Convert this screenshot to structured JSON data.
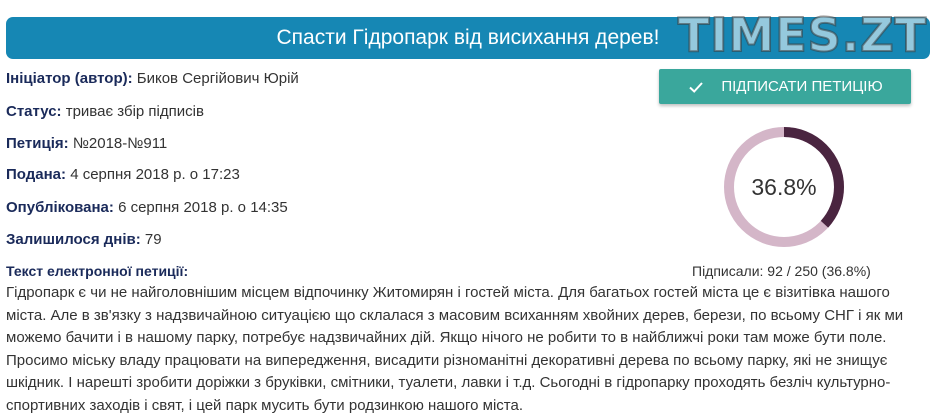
{
  "header": {
    "title": "Спасти Гідропарк від висихання дерев!",
    "watermark": "TIMES.ZT",
    "bg_color": "#1687b4"
  },
  "meta": {
    "initiator_label": "Ініціатор (автор):",
    "initiator_value": "Биков Сергійович Юрій",
    "status_label": "Статус:",
    "status_value": "триває збір підписів",
    "petition_label": "Петиція:",
    "petition_value": "№2018-№911",
    "submitted_label": "Подана:",
    "submitted_value": "4 серпня 2018 р. о 17:23",
    "published_label": "Опублікована:",
    "published_value": "6 серпня 2018 р. о 14:35",
    "days_left_label": "Залишилося днів:",
    "days_left_value": "79"
  },
  "sign_button": {
    "label": "ПІДПИСАТИ ПЕТИЦІЮ",
    "icon": "check-icon",
    "color": "#3aa79c"
  },
  "progress": {
    "percent_label": "36.8%",
    "fraction": 0.368,
    "signed_text": "Підписали: 92 / 250 (36.8%)",
    "fill_color": "#4a2540",
    "track_color": "#d4b6c8"
  },
  "petition": {
    "text_label": "Текст електронної петиції:",
    "body": "Гідропарк є чи не найголовнішим місцем відпочинку Житомирян і гостей міста. Для багатьох гостей міста це є візитівка нашого міста. Але в зв'язку з надзвичайною ситуацією що склалася з масовим всиханням хвойних дерев, берези, по всьому СНГ і як ми можемо бачити і в нашому парку, потребує надзвичайних дій. Якщо нічого не робити то в найближчі роки там може бути поле. Просимо міську владу працювати на випередження, висадити різноманітні декоративні дерева по всьому парку, які не знищує шкідник. І нарешті зробити доріжки з бруківки, смітники, туалети, лавки і т.д. Сьогодні в гідропарку проходять безліч культурно-спортивних заходів і свят, і цей парк мусить бути родзинкою нашого міста."
  }
}
